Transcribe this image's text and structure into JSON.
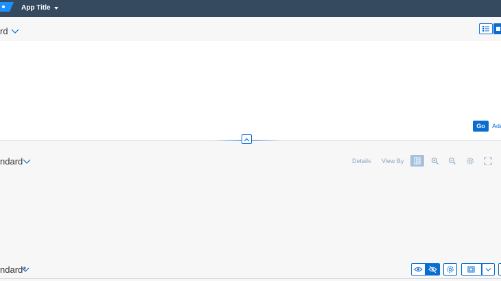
{
  "shell": {
    "app_title": "App Title"
  },
  "page_variant": {
    "title": "rd"
  },
  "filterbar": {
    "go_label": "Go",
    "adapt_label": "Ada"
  },
  "chart_variant": {
    "title": "ndard"
  },
  "chart_toolbar": {
    "details_label": "Details",
    "viewby_label": "View By"
  },
  "table_variant": {
    "title": "ndard*"
  },
  "colors": {
    "shell": "#354a5f",
    "accent": "#0a6ed1",
    "background": "#f7f7f7"
  }
}
